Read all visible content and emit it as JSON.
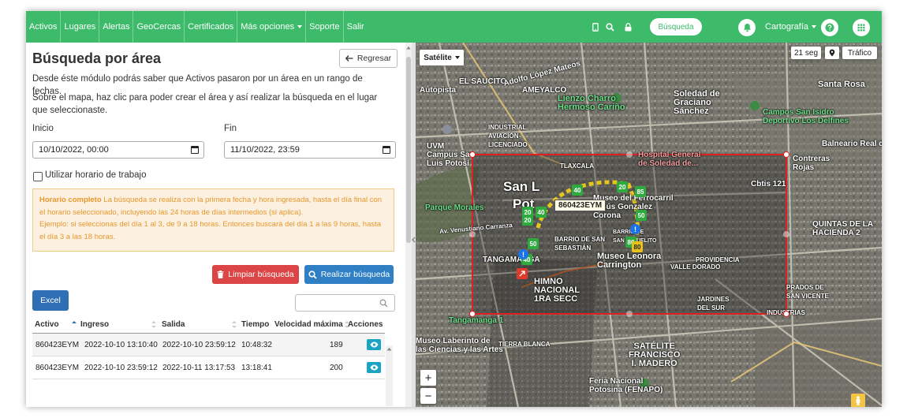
{
  "navbar": {
    "items": [
      "Activos",
      "Lugares",
      "Alertas",
      "GeoCercas",
      "Certificados",
      "Más opciones",
      "Soporte",
      "Salir"
    ],
    "search_label": "Búsqueda",
    "cartografia_label": "Cartografía",
    "color": "#3dbb6a"
  },
  "panel": {
    "title": "Búsqueda por área",
    "back_label": "Regresar",
    "description1": "Desde éste módulo podrás saber que Activos pasaron por un área en un rango de fechas.",
    "description2": "Sobre el mapa, haz clic para poder crear el área y así realizar la búsqueda en el lugar que seleccionaste.",
    "start_label": "Inicio",
    "start_value": "10/10/2022, 00:00",
    "end_label": "Fin",
    "end_value": "11/10/2022, 23:59",
    "work_hours_label": "Utilizar horario de trabajo",
    "info_title": "Horario completo",
    "info_text": " La búsqueda se realiza con la primera fecha y hora ingresada, hasta el día final con el horario seleccionado, incluyendo las 24 horas de días intermedios (si aplica).",
    "info_example": "Ejemplo: si seleccionas del día 1 al 3, de 9 a 18 horas. Entonces buscará del día 1 a las 9 horas, hasta el día 3 a las 18 horas.",
    "clear_button": "Limpiar búsqueda",
    "search_button": "Realizar búsqueda",
    "excel_button": "Excel",
    "search_placeholder": ""
  },
  "table": {
    "headers": [
      "Activo",
      "Ingreso",
      "Salida",
      "Tiempo",
      "Velocidad máxima",
      "Acciones"
    ],
    "rows": [
      {
        "activo": "860423EYM",
        "ingreso": "2022-10-10 13:10:40",
        "salida": "2022-10-10 23:59:12",
        "tiempo": "10:48:32",
        "velocidad": "189"
      },
      {
        "activo": "860423EYM",
        "ingreso": "2022-10-10 23:59:12",
        "salida": "2022-10-11 13:17:53",
        "tiempo": "13:18:41",
        "velocidad": "200"
      }
    ]
  },
  "map": {
    "type_label": "Satélite",
    "refresh_label": "21 seg",
    "traffic_label": "Tráfico",
    "zoom_in": "+",
    "zoom_out": "−",
    "vehicle_tag": "860423EYM",
    "area_color": "#e02020",
    "labels": {
      "autopista": "Autopista",
      "el_saucito": "EL SAUCITO",
      "adolfo_lopez": "Adolfo López Mateos",
      "ameyalco": "AMEYALCO",
      "lienzo": "Lienzo Charro\nHermoso Cariño",
      "soledad": "Soledad de\nGraciano\nSánchez",
      "santa_rosa": "Santa Rosa",
      "campos": "Campos San Isidro\nDeportivo Los Delfines",
      "industrial": "INDUSTRIAL\nAVIACIÓN\nLICENCIADO",
      "san_l": "San L",
      "balneario": "Balneario Real d",
      "uvm": "UVM\nCampus San\nLuis Potosí",
      "hospital": "Hospital General\nde Soledad de...",
      "contreras": "Contreras\nRojas",
      "tlaxcala": "TLAXCALA",
      "cbtis": "Cbtis 121",
      "parque": "Parque Morales",
      "pot": "Pot",
      "carranza": "Av. Venustiano Carranza",
      "museo_ferro": "Museo del Ferrocarril\nJesús Gonzalez\nCorona",
      "quintas": "QUINTAS DE LA\nHACIENDA 2",
      "barrio_sanmiguel": "BARRIO DE\nSAN MIGUELITO",
      "barrio_sebastian": "BARRIO DE SAN\nSEBASTIÁN",
      "tangamanga": "TANGAMANGA",
      "museo_leonora": "Museo Leonora\nCarrington",
      "providencia": "PROVIDENCIA",
      "valle_dorado": "VALLE DORADO",
      "himno": "HIMNO\nNACIONAL\n1RA SECC",
      "prados": "PRADOS DE\nSAN VICENTE",
      "jardines": "JARDINES\nDEL SUR",
      "industrias": "INDUSTRIAS",
      "tangamanga1": "Tangamanga 1",
      "laberinto": "Museo Laberinto de\nlas Ciencias y las Artes",
      "tierra_blanca": "TIERRA BLANCA",
      "satelite": "SATÉLITE\nFRANCISCO\nI. MADERO",
      "feria": "Feria Nacional\nPotosina (FENAPO)"
    },
    "route_markers": [
      {
        "label": "40",
        "color": "#2eaa3f"
      },
      {
        "label": "20",
        "color": "#2eaa3f"
      },
      {
        "label": "40",
        "color": "#2eaa3f"
      },
      {
        "label": "50",
        "color": "#2eaa3f"
      },
      {
        "label": "40",
        "color": "#2eaa3f"
      },
      {
        "label": "85",
        "color": "#2eaa3f"
      },
      {
        "label": "80",
        "color": "#2eaa3f"
      },
      {
        "label": "20",
        "color": "#2eaa3f"
      },
      {
        "label": "20",
        "color": "#2eaa3f"
      },
      {
        "label": "50",
        "color": "#2eaa3f"
      },
      {
        "label": "80",
        "color": "#e8c21a"
      }
    ]
  }
}
